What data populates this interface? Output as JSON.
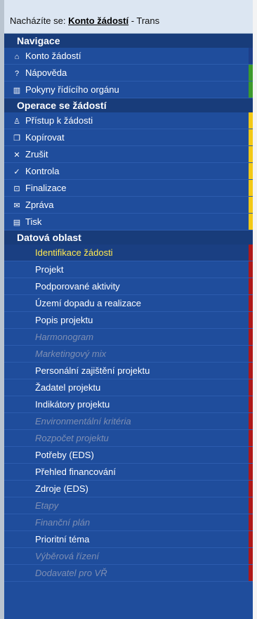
{
  "breadcrumb": {
    "prefix": "Nacházíte se:",
    "link": "Konto žádostí",
    "suffix": "- Trans"
  },
  "colors": {
    "panel": "#1f4d9c",
    "header": "#183c7a",
    "accent_blue": "#1d3f8a",
    "accent_green": "#3c9a2c",
    "accent_yellow": "#f3c916",
    "accent_red": "#b01818",
    "selected_text": "#ffe850",
    "disabled_text": "#7f8fb3"
  },
  "sections": {
    "nav": {
      "title": "Navigace",
      "items": [
        {
          "label": "Konto žádostí",
          "icon": "home-icon",
          "glyph": "⌂",
          "bar": "#1d3f8a"
        },
        {
          "label": "Nápověda",
          "icon": "help-icon",
          "glyph": "?",
          "bar": "#3c9a2c"
        },
        {
          "label": "Pokyny řídícího orgánu",
          "icon": "book-icon",
          "glyph": "▥",
          "bar": "#3c9a2c"
        }
      ]
    },
    "ops": {
      "title": "Operace se žádostí",
      "items": [
        {
          "label": "Přístup k žádosti",
          "icon": "users-icon",
          "glyph": "♙",
          "bar": "#f3c916"
        },
        {
          "label": "Kopírovat",
          "icon": "copy-icon",
          "glyph": "❐",
          "bar": "#f3c916"
        },
        {
          "label": "Zrušit",
          "icon": "cancel-icon",
          "glyph": "✕",
          "bar": "#f3c916"
        },
        {
          "label": "Kontrola",
          "icon": "check-icon",
          "glyph": "✓",
          "bar": "#f3c916"
        },
        {
          "label": "Finalizace",
          "icon": "lock-icon",
          "glyph": "⊡",
          "bar": "#f3c916"
        },
        {
          "label": "Zpráva",
          "icon": "message-icon",
          "glyph": "✉",
          "bar": "#f3c916"
        },
        {
          "label": "Tisk",
          "icon": "print-icon",
          "glyph": "▤",
          "bar": "#f3c916"
        }
      ]
    },
    "data": {
      "title": "Datová oblast",
      "items": [
        {
          "label": "Identifikace žádosti",
          "state": "selected"
        },
        {
          "label": "Projekt",
          "state": "enabled"
        },
        {
          "label": "Podporované aktivity",
          "state": "enabled"
        },
        {
          "label": "Území dopadu a realizace",
          "state": "enabled"
        },
        {
          "label": "Popis projektu",
          "state": "enabled"
        },
        {
          "label": "Harmonogram",
          "state": "disabled"
        },
        {
          "label": "Marketingový mix",
          "state": "disabled"
        },
        {
          "label": "Personální zajištění projektu",
          "state": "enabled"
        },
        {
          "label": "Žadatel projektu",
          "state": "enabled"
        },
        {
          "label": "Indikátory projektu",
          "state": "enabled"
        },
        {
          "label": "Environmentální kritéria",
          "state": "disabled"
        },
        {
          "label": "Rozpočet projektu",
          "state": "disabled"
        },
        {
          "label": "Potřeby (EDS)",
          "state": "enabled"
        },
        {
          "label": "Přehled financování",
          "state": "enabled"
        },
        {
          "label": "Zdroje (EDS)",
          "state": "enabled"
        },
        {
          "label": "Etapy",
          "state": "disabled"
        },
        {
          "label": "Finanční plán",
          "state": "disabled"
        },
        {
          "label": "Prioritní téma",
          "state": "enabled"
        },
        {
          "label": "Výběrová řízení",
          "state": "disabled"
        },
        {
          "label": "Dodavatel pro VŘ",
          "state": "disabled"
        }
      ]
    }
  }
}
